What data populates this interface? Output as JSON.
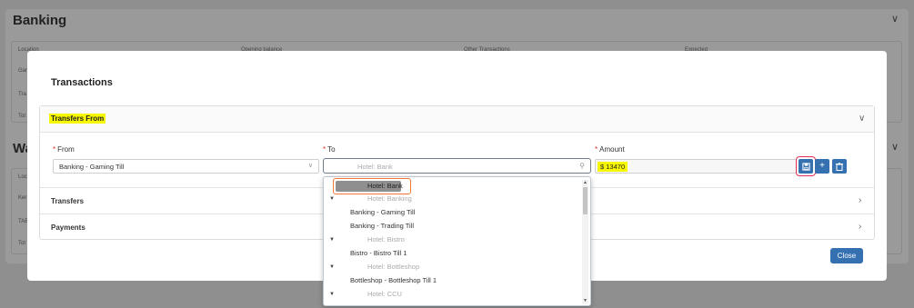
{
  "background": {
    "title": "Banking",
    "section2_title": "Wa",
    "table1_headers": [
      "Location",
      "Opening balance",
      "Other Transactions",
      "Expected"
    ],
    "table1_rows": [
      "Gam",
      "Tra",
      "Tot"
    ],
    "table2_headers": [
      "Loc"
    ],
    "table2_rows": [
      "Ker",
      "TAE",
      "Tot"
    ]
  },
  "modal": {
    "title": "Transactions",
    "transfers_from": {
      "title": "Transfers From",
      "from_label": "From",
      "from_value": "Banking - Gaming Till",
      "to_label": "To",
      "to_placeholder": "Hotel: Bank",
      "amount_label": "Amount",
      "amount_value": "$ 13470"
    },
    "sections": [
      {
        "title": "Transfers"
      },
      {
        "title": "Payments"
      }
    ],
    "close_label": "Close"
  },
  "dropdown": {
    "selected": "Hotel: Bank",
    "items": [
      {
        "type": "group",
        "label": "Hotel: Banking"
      },
      {
        "type": "option",
        "label": "Banking - Gaming Till"
      },
      {
        "type": "option",
        "label": "Banking - Trading Till"
      },
      {
        "type": "group",
        "label": "Hotel: Bistro"
      },
      {
        "type": "option",
        "label": "Bistro - Bistro Till 1"
      },
      {
        "type": "group",
        "label": "Hotel: Bottleshop"
      },
      {
        "type": "option",
        "label": "Bottleshop - Bottleshop Till 1"
      },
      {
        "type": "group",
        "label": "Hotel: CCU"
      }
    ]
  },
  "colors": {
    "highlight": "#f7f700",
    "primary_button": "#3570b0",
    "required_marker": "#e0301e"
  },
  "icons": {
    "chevron_down": "chevron-down-icon",
    "chevron_right": "chevron-right-icon",
    "save": "save-icon",
    "add": "plus-icon",
    "delete": "trash-icon",
    "search": "search-icon"
  }
}
